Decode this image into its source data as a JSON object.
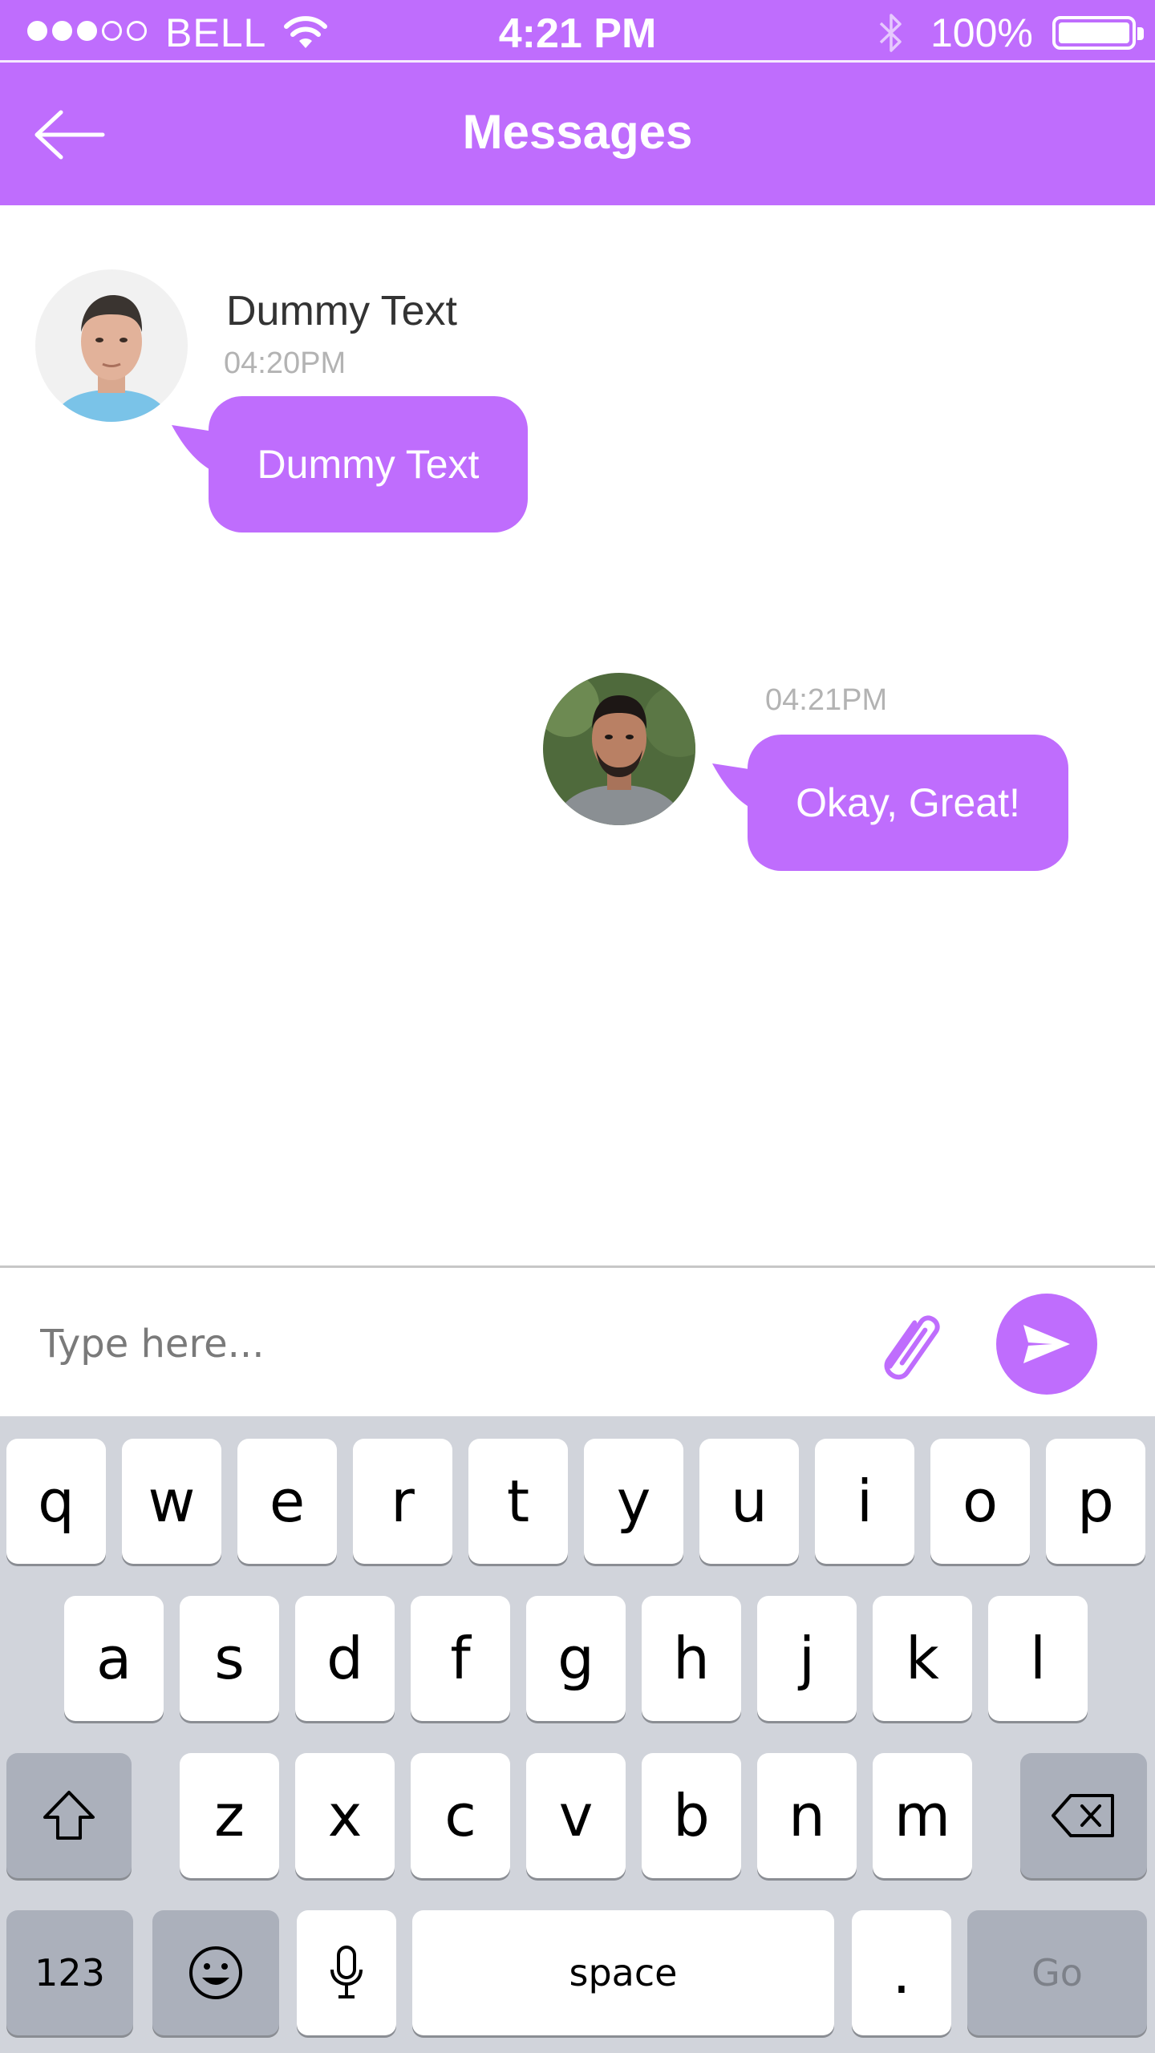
{
  "status_bar": {
    "carrier": "BELL",
    "signal_bars_on": 3,
    "signal_bars_total": 5,
    "time": "4:21 PM",
    "battery": "100%",
    "battery_level": 1.0
  },
  "header": {
    "title": "Messages",
    "back_icon": "arrow-left-icon"
  },
  "messages": [
    {
      "side": "left",
      "sender": "Dummy Text",
      "time": "04:20PM",
      "text": "Dummy Text"
    },
    {
      "side": "right",
      "time": "04:21PM",
      "text": "Okay, Great!"
    }
  ],
  "composer": {
    "placeholder": "Type here...",
    "attach_icon": "paperclip-icon",
    "send_icon": "send-icon"
  },
  "keyboard": {
    "row1": [
      "q",
      "w",
      "e",
      "r",
      "t",
      "y",
      "u",
      "i",
      "o",
      "p"
    ],
    "row2": [
      "a",
      "s",
      "d",
      "f",
      "g",
      "h",
      "j",
      "k",
      "l"
    ],
    "row3": [
      "z",
      "x",
      "c",
      "v",
      "b",
      "n",
      "m"
    ],
    "numbers_key": "123",
    "space_key": "space",
    "period_key": ".",
    "go_key": "Go"
  },
  "colors": {
    "accent": "#bf6dfd",
    "keyboard_bg": "#d1d4db",
    "key_dark": "#abb0bb"
  }
}
